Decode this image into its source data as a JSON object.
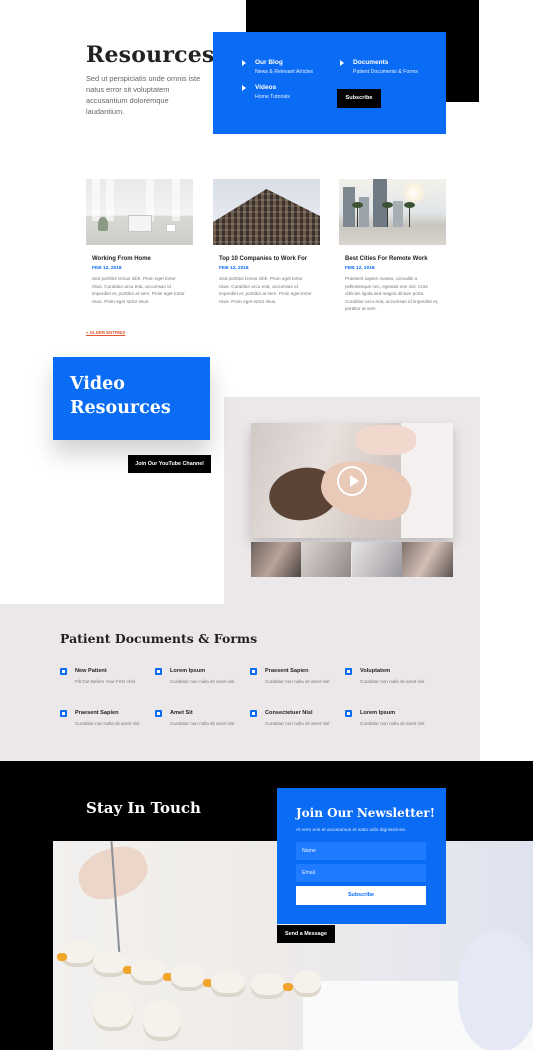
{
  "resources": {
    "title": "Resources",
    "description": "Sed ut perspiciatis unde omnis iste natus error sit voluptatem accusantium doloremque laudantium.",
    "nav": [
      {
        "title": "Our Blog",
        "sub": "News & Relevant Articles"
      },
      {
        "title": "Videos",
        "sub": "Home Tutorials"
      },
      {
        "title": "Documents",
        "sub": "Patient Documents & Forms"
      }
    ],
    "subscribe_label": "Subscribe"
  },
  "blog": {
    "posts": [
      {
        "title": "Working From Home",
        "date": "FEB 12, 2018",
        "excerpt": "Sed porttitor lectus nibh. Proin eget tortor risus. Curabitur arcu erat, accumsan id imperdiet et, porttitor at sem. Proin eget tortor risus. Proin eget tortor risus."
      },
      {
        "title": "Top 10 Companies to Work For",
        "date": "FEB 12, 2018",
        "excerpt": "Sed porttitor lectus nibh. Proin eget tortor risus. Curabitur arcu erat, accumsan id imperdiet et, porttitor at sem. Proin eget tortor risus. Proin eget tortor risus."
      },
      {
        "title": "Best Cities For Remote Work",
        "date": "FEB 12, 2018",
        "excerpt": "Praesent sapien massa, convallis a pellentesque nec, egestas non nisi. Cras ultricies ligula sed magna dictum porta. Curabitur arcu erat, accumsan id imperdiet et, porttitor at sem."
      }
    ],
    "older_label": "« OLDER ENTRIES"
  },
  "video": {
    "title_line1": "Video",
    "title_line2": "Resources",
    "youtube_label": "Join Our YouTube Channel"
  },
  "documents": {
    "title": "Patient Documents & Forms",
    "items": [
      {
        "title": "New Patient",
        "desc": "Fill Out Before Your First Visit"
      },
      {
        "title": "Lorem Ipsum",
        "desc": "Curabitur non nulla sit amet nisl"
      },
      {
        "title": "Praesent Sapien",
        "desc": "Curabitur non nulla sit amet nisl"
      },
      {
        "title": "Voluptatem",
        "desc": "Curabitur non nulla sit amet nisl"
      },
      {
        "title": "Praesent Sapien",
        "desc": "Curabitur non nulla sit amet nisl"
      },
      {
        "title": "Amet Sit",
        "desc": "Curabitur non nulla sit amet nisl"
      },
      {
        "title": "Consectetuer Nisl",
        "desc": "Curabitur non nulla sit amet nisl"
      },
      {
        "title": "Lorem Ipsum",
        "desc": "Curabitur non nulla sit amet nisl"
      }
    ]
  },
  "touch": {
    "title": "Stay In Touch",
    "send_label": "Send a Message"
  },
  "newsletter": {
    "title": "Join Our Newsletter!",
    "subtitle": "At vero eos et accusamus et iusto odio dignissimos.",
    "name_placeholder": "Name",
    "email_placeholder": "Email",
    "subscribe_label": "Subscribe"
  },
  "colors": {
    "accent": "#0a6cf5",
    "black": "#000000",
    "band": "#ece8ea",
    "link": "#e2582f"
  }
}
